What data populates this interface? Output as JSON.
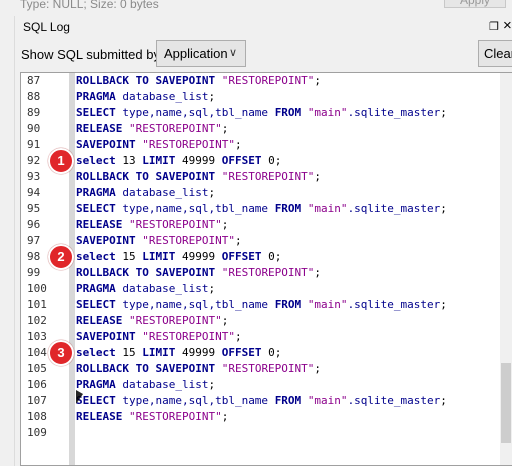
{
  "top": {
    "type_text": "Type: NULL; Size: 0 bytes",
    "apply_label": "Apply"
  },
  "sql_log": {
    "title": "SQL Log",
    "show_label": "Show SQL submitted by",
    "source_value": "Application",
    "clear_label": "Clear"
  },
  "lines": [
    {
      "num": "87",
      "code": [
        {
          "t": "ROLLBACK TO SAVEPOINT ",
          "c": "k"
        },
        {
          "t": "\"RESTOREPOINT\"",
          "c": "s"
        },
        {
          "t": ";",
          "c": "n"
        }
      ]
    },
    {
      "num": "88",
      "code": [
        {
          "t": "PRAGMA ",
          "c": "k"
        },
        {
          "t": "database_list",
          "c": "f"
        },
        {
          "t": ";",
          "c": "n"
        }
      ]
    },
    {
      "num": "89",
      "code": [
        {
          "t": "SELECT ",
          "c": "k"
        },
        {
          "t": "type,name,sql,tbl_name ",
          "c": "f"
        },
        {
          "t": "FROM ",
          "c": "k"
        },
        {
          "t": "\"main\"",
          "c": "s"
        },
        {
          "t": ".sqlite_master",
          "c": "f"
        },
        {
          "t": ";",
          "c": "n"
        }
      ]
    },
    {
      "num": "90",
      "code": [
        {
          "t": "RELEASE ",
          "c": "k"
        },
        {
          "t": "\"RESTOREPOINT\"",
          "c": "s"
        },
        {
          "t": ";",
          "c": "n"
        }
      ]
    },
    {
      "num": "91",
      "code": [
        {
          "t": "SAVEPOINT ",
          "c": "k"
        },
        {
          "t": "\"RESTOREPOINT\"",
          "c": "s"
        },
        {
          "t": ";",
          "c": "n"
        }
      ]
    },
    {
      "num": "92",
      "code": [
        {
          "t": "select ",
          "c": "k"
        },
        {
          "t": "13 ",
          "c": "n"
        },
        {
          "t": "LIMIT ",
          "c": "k"
        },
        {
          "t": "49999 ",
          "c": "n"
        },
        {
          "t": "OFFSET ",
          "c": "k"
        },
        {
          "t": "0;",
          "c": "n"
        }
      ]
    },
    {
      "num": "93",
      "code": [
        {
          "t": "ROLLBACK TO SAVEPOINT ",
          "c": "k"
        },
        {
          "t": "\"RESTOREPOINT\"",
          "c": "s"
        },
        {
          "t": ";",
          "c": "n"
        }
      ]
    },
    {
      "num": "94",
      "code": [
        {
          "t": "PRAGMA ",
          "c": "k"
        },
        {
          "t": "database_list",
          "c": "f"
        },
        {
          "t": ";",
          "c": "n"
        }
      ]
    },
    {
      "num": "95",
      "code": [
        {
          "t": "SELECT ",
          "c": "k"
        },
        {
          "t": "type,name,sql,tbl_name ",
          "c": "f"
        },
        {
          "t": "FROM ",
          "c": "k"
        },
        {
          "t": "\"main\"",
          "c": "s"
        },
        {
          "t": ".sqlite_master",
          "c": "f"
        },
        {
          "t": ";",
          "c": "n"
        }
      ]
    },
    {
      "num": "96",
      "code": [
        {
          "t": "RELEASE ",
          "c": "k"
        },
        {
          "t": "\"RESTOREPOINT\"",
          "c": "s"
        },
        {
          "t": ";",
          "c": "n"
        }
      ]
    },
    {
      "num": "97",
      "code": [
        {
          "t": "SAVEPOINT ",
          "c": "k"
        },
        {
          "t": "\"RESTOREPOINT\"",
          "c": "s"
        },
        {
          "t": ";",
          "c": "n"
        }
      ]
    },
    {
      "num": "98",
      "code": [
        {
          "t": "select ",
          "c": "k"
        },
        {
          "t": "15 ",
          "c": "n"
        },
        {
          "t": "LIMIT ",
          "c": "k"
        },
        {
          "t": "49999 ",
          "c": "n"
        },
        {
          "t": "OFFSET ",
          "c": "k"
        },
        {
          "t": "0;",
          "c": "n"
        }
      ]
    },
    {
      "num": "99",
      "code": [
        {
          "t": "ROLLBACK TO SAVEPOINT ",
          "c": "k"
        },
        {
          "t": "\"RESTOREPOINT\"",
          "c": "s"
        },
        {
          "t": ";",
          "c": "n"
        }
      ]
    },
    {
      "num": "100",
      "code": [
        {
          "t": "PRAGMA ",
          "c": "k"
        },
        {
          "t": "database_list",
          "c": "f"
        },
        {
          "t": ";",
          "c": "n"
        }
      ]
    },
    {
      "num": "101",
      "code": [
        {
          "t": "SELECT ",
          "c": "k"
        },
        {
          "t": "type,name,sql,tbl_name ",
          "c": "f"
        },
        {
          "t": "FROM ",
          "c": "k"
        },
        {
          "t": "\"main\"",
          "c": "s"
        },
        {
          "t": ".sqlite_master",
          "c": "f"
        },
        {
          "t": ";",
          "c": "n"
        }
      ]
    },
    {
      "num": "102",
      "code": [
        {
          "t": "RELEASE ",
          "c": "k"
        },
        {
          "t": "\"RESTOREPOINT\"",
          "c": "s"
        },
        {
          "t": ";",
          "c": "n"
        }
      ]
    },
    {
      "num": "103",
      "code": [
        {
          "t": "SAVEPOINT ",
          "c": "k"
        },
        {
          "t": "\"RESTOREPOINT\"",
          "c": "s"
        },
        {
          "t": ";",
          "c": "n"
        }
      ]
    },
    {
      "num": "104",
      "code": [
        {
          "t": "select ",
          "c": "k"
        },
        {
          "t": "15 ",
          "c": "n"
        },
        {
          "t": "LIMIT ",
          "c": "k"
        },
        {
          "t": "49999 ",
          "c": "n"
        },
        {
          "t": "OFFSET ",
          "c": "k"
        },
        {
          "t": "0;",
          "c": "n"
        }
      ]
    },
    {
      "num": "105",
      "code": [
        {
          "t": "ROLLBACK TO SAVEPOINT ",
          "c": "k"
        },
        {
          "t": "\"RESTOREPOINT\"",
          "c": "s"
        },
        {
          "t": ";",
          "c": "n"
        }
      ]
    },
    {
      "num": "106",
      "code": [
        {
          "t": "PRAGMA ",
          "c": "k"
        },
        {
          "t": "database_list",
          "c": "f"
        },
        {
          "t": ";",
          "c": "n"
        }
      ]
    },
    {
      "num": "107",
      "code": [
        {
          "t": "SELECT ",
          "c": "k"
        },
        {
          "t": "type,name,sql,tbl_name ",
          "c": "f"
        },
        {
          "t": "FROM ",
          "c": "k"
        },
        {
          "t": "\"main\"",
          "c": "s"
        },
        {
          "t": ".sqlite_master",
          "c": "f"
        },
        {
          "t": ";",
          "c": "n"
        }
      ]
    },
    {
      "num": "108",
      "code": [
        {
          "t": "RELEASE ",
          "c": "k"
        },
        {
          "t": "\"RESTOREPOINT\"",
          "c": "s"
        },
        {
          "t": ";",
          "c": "n"
        }
      ]
    },
    {
      "num": "109",
      "code": []
    }
  ],
  "badges": [
    {
      "label": "1",
      "line": 5
    },
    {
      "label": "2",
      "line": 11
    },
    {
      "label": "3",
      "line": 17
    }
  ],
  "colors": {
    "keyword": "#00008b",
    "string": "#8b008b",
    "badge": "#e0262a"
  }
}
